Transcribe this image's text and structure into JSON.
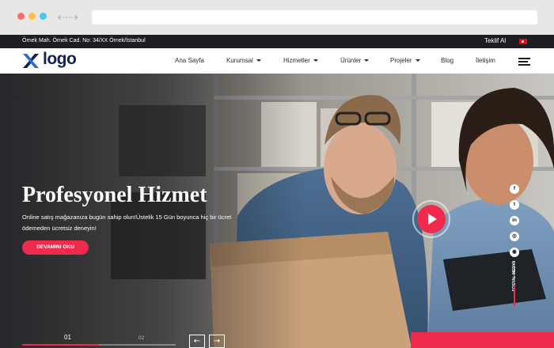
{
  "topbar": {
    "address": "Örnek Mah. Örnek Cad. No: 34/XX Örnek/İstanbul",
    "quote_link": "Teklif Al",
    "flag_icon": "turkey-flag-icon"
  },
  "header": {
    "logo_text": "logo",
    "menu": [
      {
        "label": "Ana Sayfa",
        "has_dropdown": false
      },
      {
        "label": "Kurumsal",
        "has_dropdown": true
      },
      {
        "label": "Hizmetler",
        "has_dropdown": true
      },
      {
        "label": "Ürünler",
        "has_dropdown": true
      },
      {
        "label": "Projeler",
        "has_dropdown": true
      },
      {
        "label": "Blog",
        "has_dropdown": false
      },
      {
        "label": "İletişim",
        "has_dropdown": false
      }
    ],
    "menu_icon": "hamburger-menu-icon"
  },
  "hero": {
    "title": "Profesyonel Hizmet",
    "description": "Online satış mağazanıza bugün sahip olun!Üstelik 15 Gün boyunca hiç bir ücret ödemeden ücretsiz deneyin!",
    "button_label": "DEVAMINI OKU",
    "play_icon": "play-icon",
    "social": {
      "label": "SOSYAL MEDYA",
      "icons": [
        "f",
        "t",
        "in",
        "◎",
        "◉"
      ]
    },
    "slider": {
      "current": "01",
      "next": "02",
      "progress_percent": 50,
      "prev_arrow": "←",
      "next_arrow": "→"
    }
  },
  "colors": {
    "accent": "#ee2b4c",
    "dark": "#1d1e24",
    "brand_navy": "#16224f",
    "brand_blue": "#1e6fd9"
  }
}
